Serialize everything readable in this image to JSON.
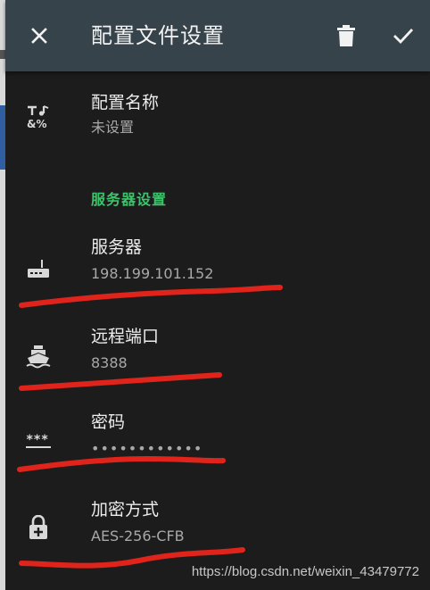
{
  "appbar": {
    "title": "配置文件设置",
    "icons": [
      "close-icon",
      "delete-icon",
      "check-icon"
    ]
  },
  "profile": {
    "label": "配置名称",
    "value": "未设置",
    "icon": "text-format-icon"
  },
  "server_section": {
    "header": "服务器设置",
    "header_color": "#3bc46a"
  },
  "items": [
    {
      "label": "服务器",
      "value": "198.199.101.152",
      "icon": "router-icon"
    },
    {
      "label": "远程端口",
      "value": "8388",
      "icon": "ship-icon"
    },
    {
      "label": "密码",
      "value": "••••••••••••",
      "icon": "password-icon"
    },
    {
      "label": "加密方式",
      "value": "AES-256-CFB",
      "icon": "lock-icon"
    }
  ],
  "watermark": "https://blog.csdn.net/weixin_43479772",
  "colors": {
    "appbar": "#36434b",
    "background": "#1c1c1c",
    "scribble": "#e0231b"
  }
}
